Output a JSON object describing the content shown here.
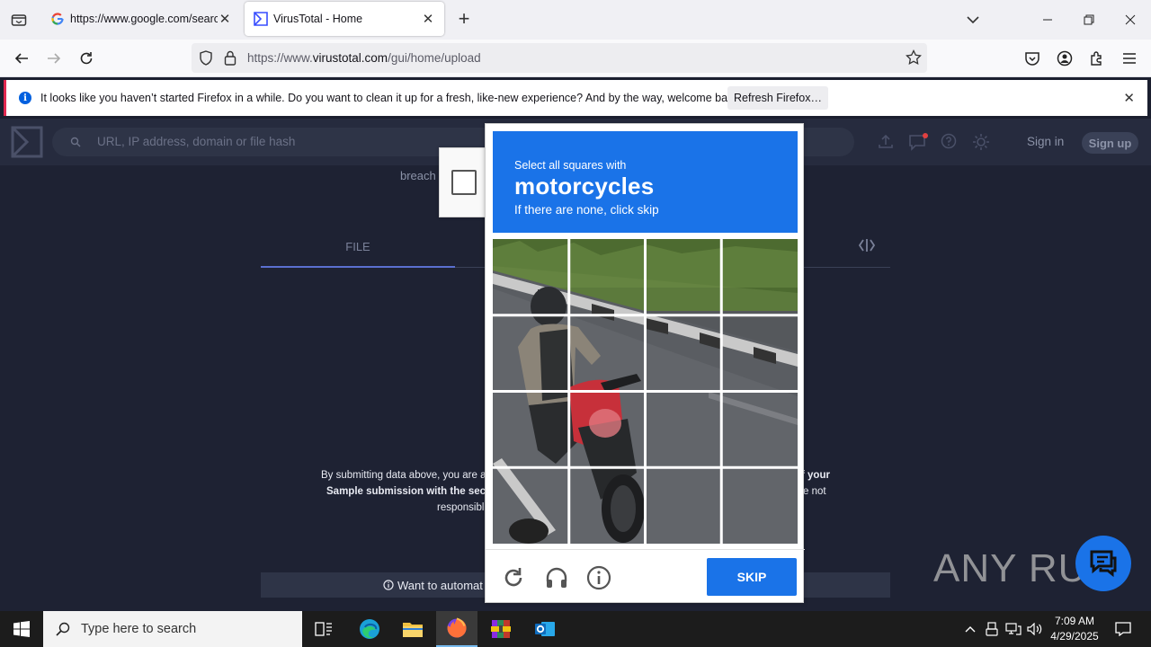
{
  "browser": {
    "tabs": [
      {
        "title": "https://www.google.com/search",
        "active": false
      },
      {
        "title": "VirusTotal - Home",
        "active": true
      }
    ],
    "url_prefix": "https://www.",
    "url_domain": "virustotal.com",
    "url_path": "/gui/home/upload",
    "notification": {
      "message": "It looks like you haven’t started Firefox in a while. Do you want to clean it up for a fresh, like-new experience? And by the way, welcome back!",
      "button": "Refresh Firefox…"
    }
  },
  "virustotal": {
    "search_placeholder": "URL, IP address, domain or file hash",
    "sign_in": "Sign in",
    "sign_up": "Sign up",
    "partial_text": "breach",
    "tab_file": "FILE",
    "terms_line1_a": "By submitting data above, you are ag",
    "terms_line1_b": "f your",
    "terms_line2_a": "Sample submission with the secur",
    "terms_line2_b": "e not",
    "terms_line3": "responsibl",
    "automate": "Want to automat"
  },
  "captcha": {
    "instruction": "Select all squares with",
    "target": "motorcycles",
    "hint": "If there are none, click skip",
    "skip": "SKIP"
  },
  "watermark": "ANY RUN",
  "taskbar": {
    "search_placeholder": "Type here to search",
    "time": "7:09 AM",
    "date": "4/29/2025"
  },
  "colors": {
    "captcha_blue": "#1a73e8",
    "vt_background": "#1e2233",
    "notice_accent": "#e22850"
  }
}
